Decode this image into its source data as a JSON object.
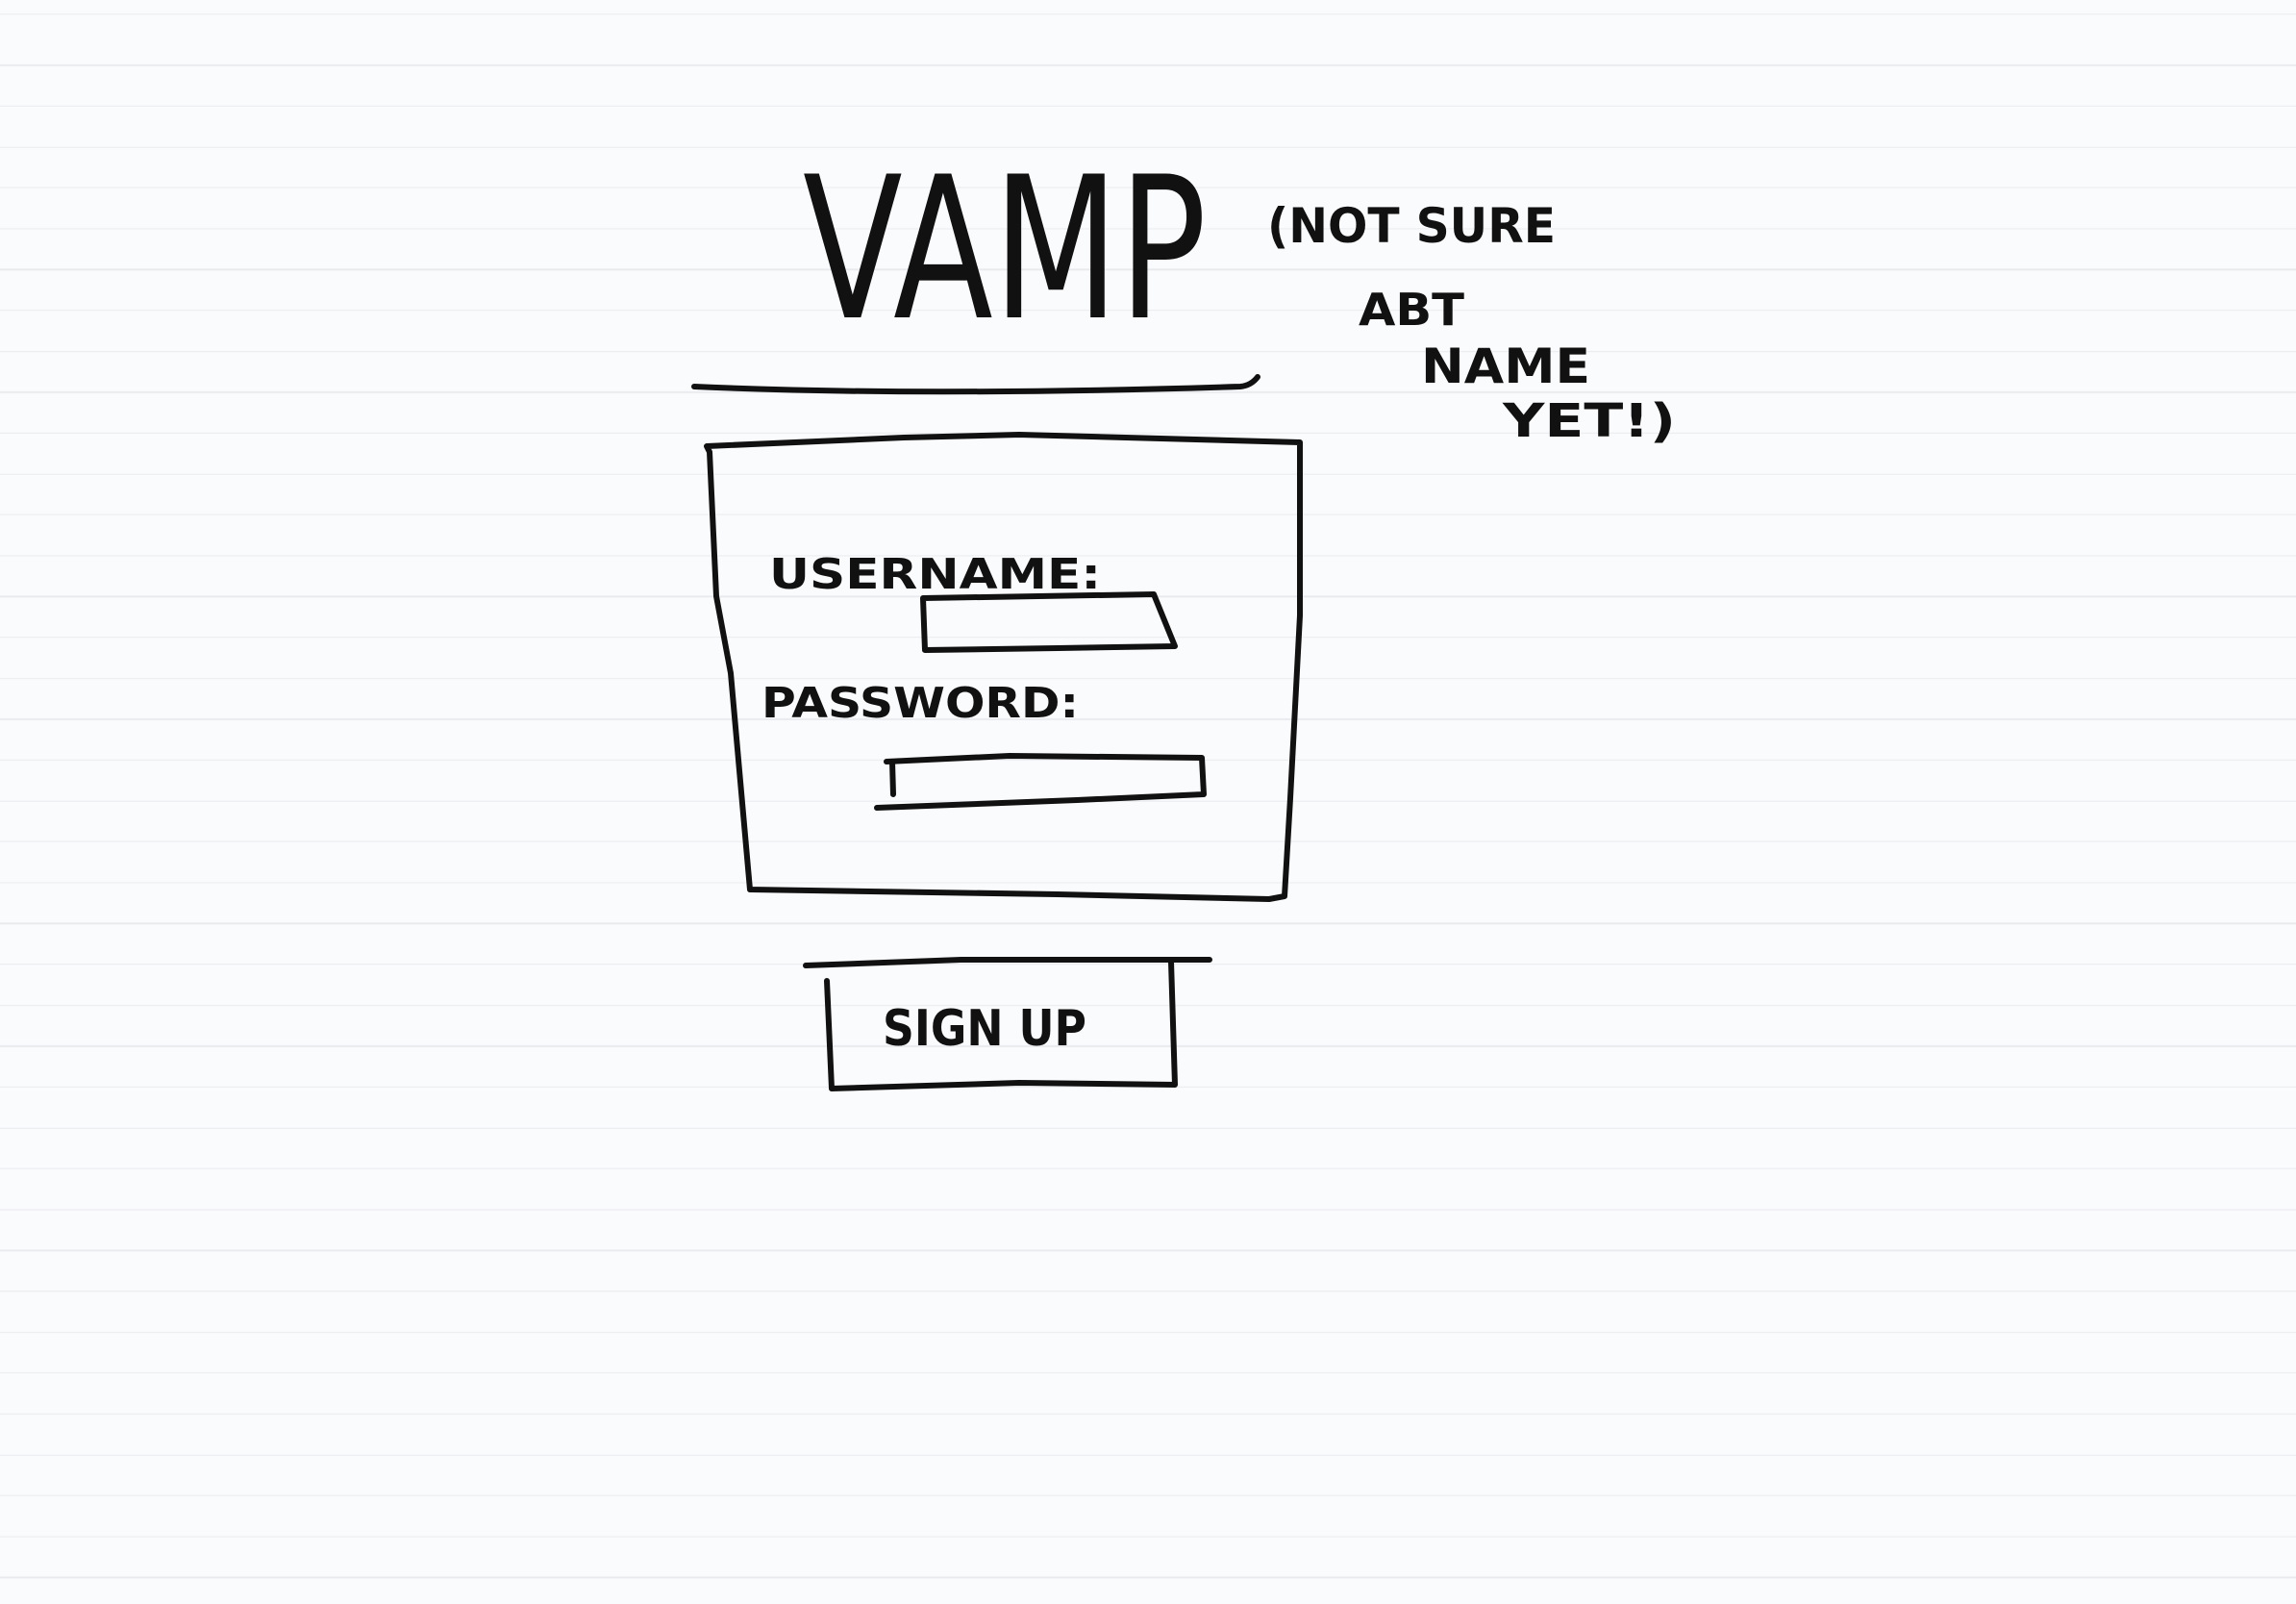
{
  "app": {
    "title": "VAMP"
  },
  "note": {
    "line1": "(NOT SURE",
    "line2": "ABT",
    "line3": "NAME",
    "line4": "YET!)"
  },
  "login_form": {
    "username_label": "USERNAME:",
    "username_value": "",
    "password_label": "PASSWORD:",
    "password_value": ""
  },
  "signup_button": {
    "label": "SIGN UP"
  },
  "colors": {
    "ink": "#111111",
    "paper": "#fafbfd",
    "ruling": "#e8eaee"
  }
}
